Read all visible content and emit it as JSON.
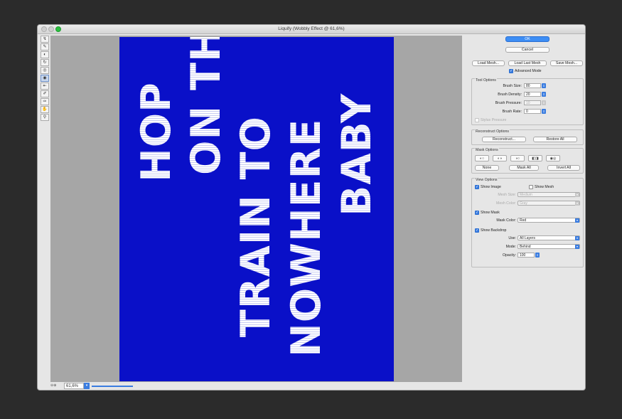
{
  "window": {
    "title": "Liquify (Wobbly Effect @ 61,6%)"
  },
  "tools": [
    {
      "icon": "forward-warp-icon",
      "glyph": "↯"
    },
    {
      "icon": "reconstruct-icon",
      "glyph": "✎"
    },
    {
      "icon": "smooth-icon",
      "glyph": "◐"
    },
    {
      "icon": "twirl-icon",
      "glyph": "↻"
    },
    {
      "icon": "pucker-icon",
      "glyph": "◎"
    },
    {
      "icon": "bloat-icon",
      "glyph": "◉"
    },
    {
      "icon": "push-left-icon",
      "glyph": "⇤"
    },
    {
      "icon": "freeze-mask-icon",
      "glyph": "✐"
    },
    {
      "icon": "thaw-mask-icon",
      "glyph": "✑"
    },
    {
      "icon": "hand-icon",
      "glyph": "✋"
    },
    {
      "icon": "zoom-icon",
      "glyph": "⚲"
    }
  ],
  "canvas": {
    "background_color": "#0a10c8",
    "lines": [
      "HOP",
      "ON THE",
      "TRAIN TO",
      "NOWHERE",
      "BABY"
    ]
  },
  "status": {
    "zoom": "61,6%",
    "zoom_icon": "dropdown-arrow-icon"
  },
  "panel": {
    "ok_label": "OK",
    "cancel_label": "Cancel",
    "load_mesh_label": "Load Mesh...",
    "load_last_mesh_label": "Load Last Mesh",
    "save_mesh_label": "Save Mesh...",
    "advanced_mode_label": "Advanced Mode",
    "advanced_mode_checked": true,
    "tool_options": {
      "title": "Tool Options",
      "brush_size_label": "Brush Size:",
      "brush_size": "80",
      "brush_density_label": "Brush Density:",
      "brush_density": "20",
      "brush_pressure_label": "Brush Pressure:",
      "brush_pressure": "10",
      "brush_rate_label": "Brush Rate:",
      "brush_rate": "0",
      "stylus_pressure_label": "Stylus Pressure"
    },
    "reconstruct_options": {
      "title": "Reconstruct Options",
      "reconstruct_label": "Reconstruct...",
      "restore_all_label": "Restore All"
    },
    "mask_options": {
      "title": "Mask Options",
      "none_label": "None",
      "mask_all_label": "Mask All",
      "invert_all_label": "Invert All"
    },
    "view_options": {
      "title": "View Options",
      "show_image_label": "Show Image",
      "show_mesh_top_label": "Show Mesh",
      "mesh_size_label": "Mesh Size:",
      "mesh_size": "Medium",
      "mesh_color_label": "Mesh Color:",
      "mesh_color": "Gray",
      "show_mask_label": "Show Mask",
      "mask_color_label": "Mask Color:",
      "mask_color": "Red",
      "show_backdrop_label": "Show Backdrop",
      "use_label": "Use:",
      "use_value": "All Layers",
      "mode_label": "Mode:",
      "mode_value": "Behind",
      "opacity_label": "Opacity:",
      "opacity_value": "100"
    }
  },
  "colors": {
    "accent": "#3b7de0",
    "canvas_bg": "#0a10c8",
    "stage_gray": "#a6a6a6"
  }
}
